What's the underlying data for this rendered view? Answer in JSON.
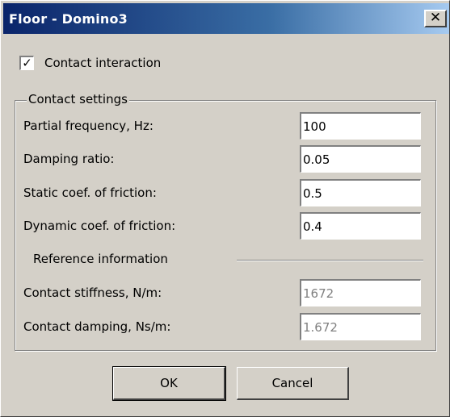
{
  "window": {
    "title": "Floor - Domino3",
    "close_glyph": "✕"
  },
  "contact_interaction": {
    "label": "Contact interaction",
    "checked": true,
    "check_glyph": "✓"
  },
  "contact_settings": {
    "legend": "Contact settings",
    "fields": [
      {
        "label": "Partial frequency, Hz:",
        "value": "100"
      },
      {
        "label": "Damping ratio:",
        "value": "0.05"
      },
      {
        "label": "Static coef. of friction:",
        "value": "0.5"
      },
      {
        "label": "Dynamic coef. of friction:",
        "value": "0.4"
      }
    ],
    "reference_label": "Reference information",
    "reference_fields": [
      {
        "label": "Contact stiffness, N/m:",
        "value": "1672"
      },
      {
        "label": "Contact damping, Ns/m:",
        "value": "1.672"
      }
    ]
  },
  "buttons": {
    "ok": "OK",
    "cancel": "Cancel"
  }
}
